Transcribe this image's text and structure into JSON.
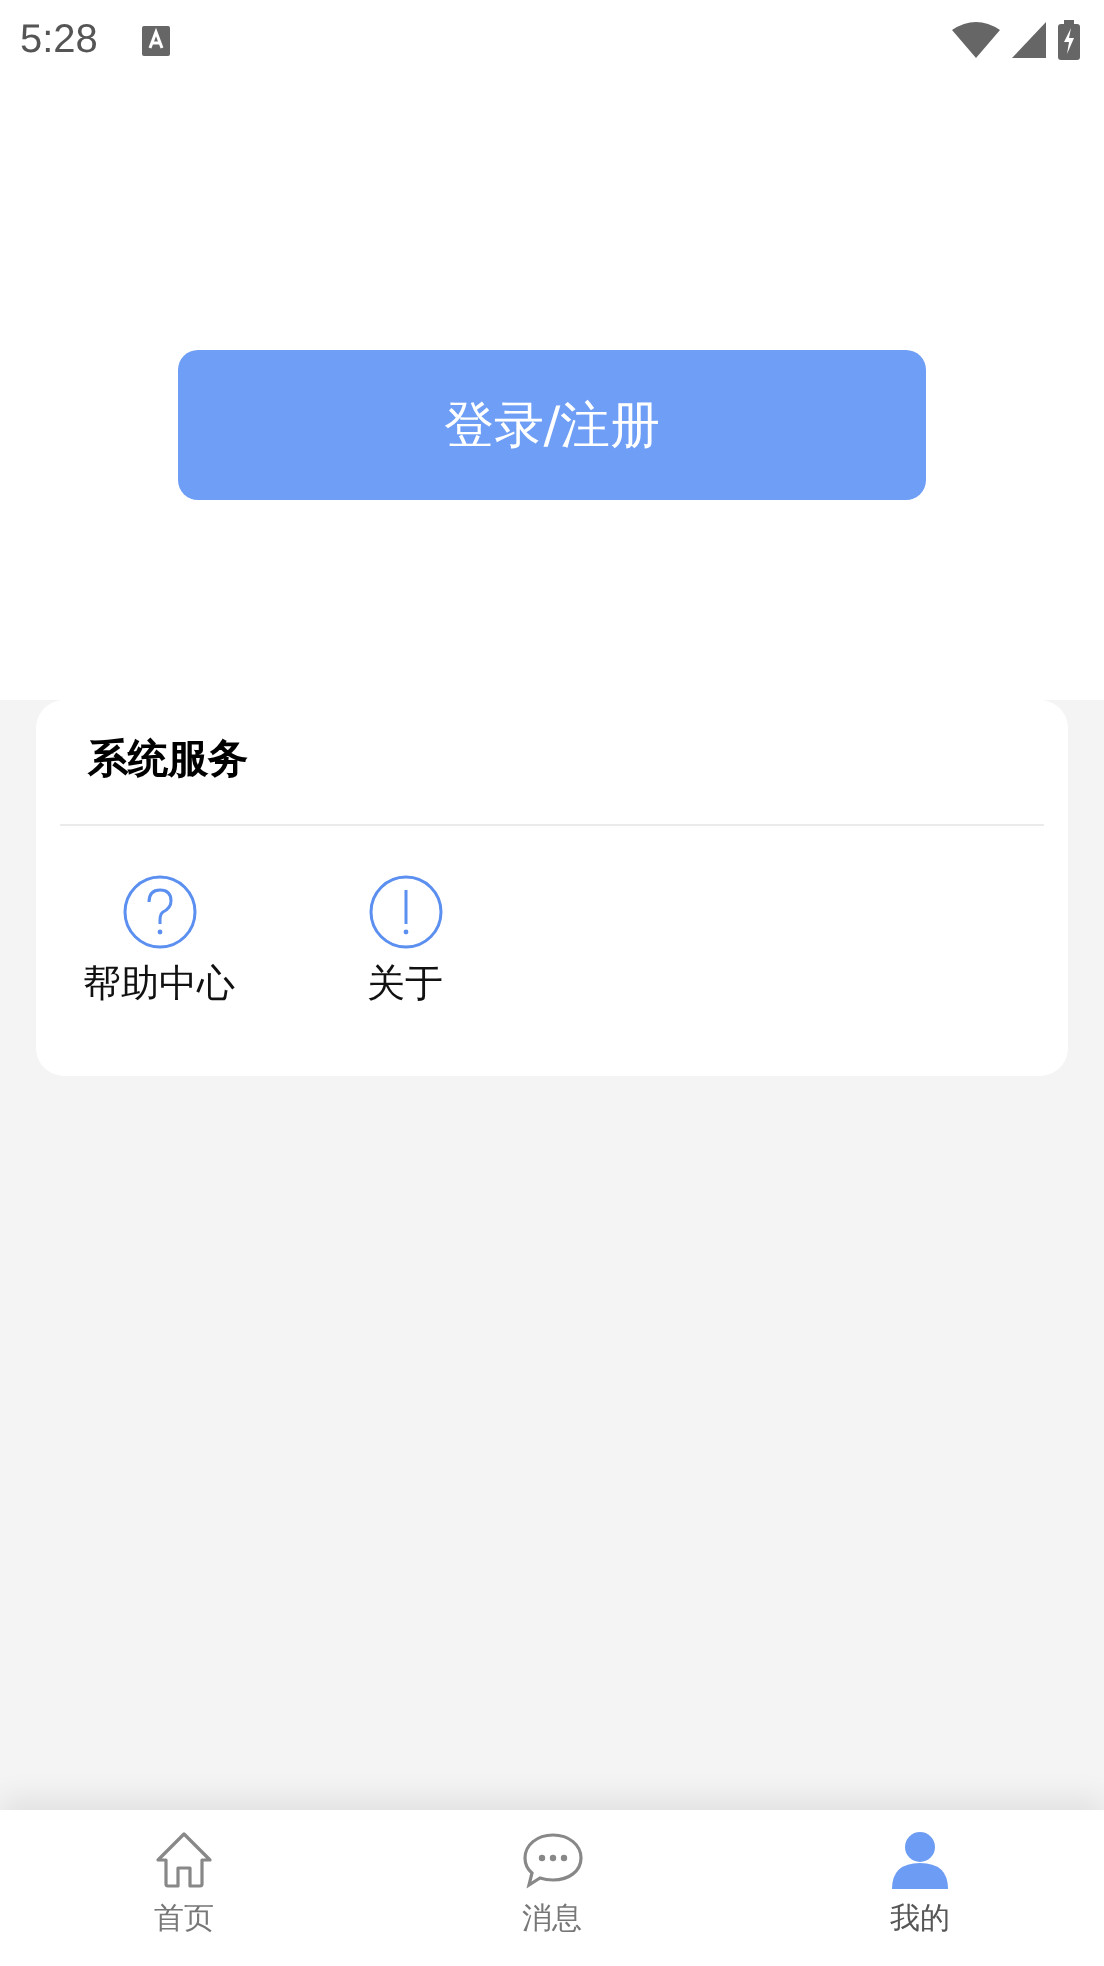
{
  "status_bar": {
    "time": "5:28"
  },
  "login_button": {
    "label": "登录/注册"
  },
  "services": {
    "title": "系统服务",
    "items": [
      {
        "kind": "help",
        "label": "帮助中心"
      },
      {
        "kind": "about",
        "label": "关于"
      }
    ]
  },
  "tabs": [
    {
      "kind": "home",
      "label": "首页",
      "selected": false
    },
    {
      "kind": "message",
      "label": "消息",
      "selected": false
    },
    {
      "kind": "profile",
      "label": "我的",
      "selected": true
    }
  ]
}
